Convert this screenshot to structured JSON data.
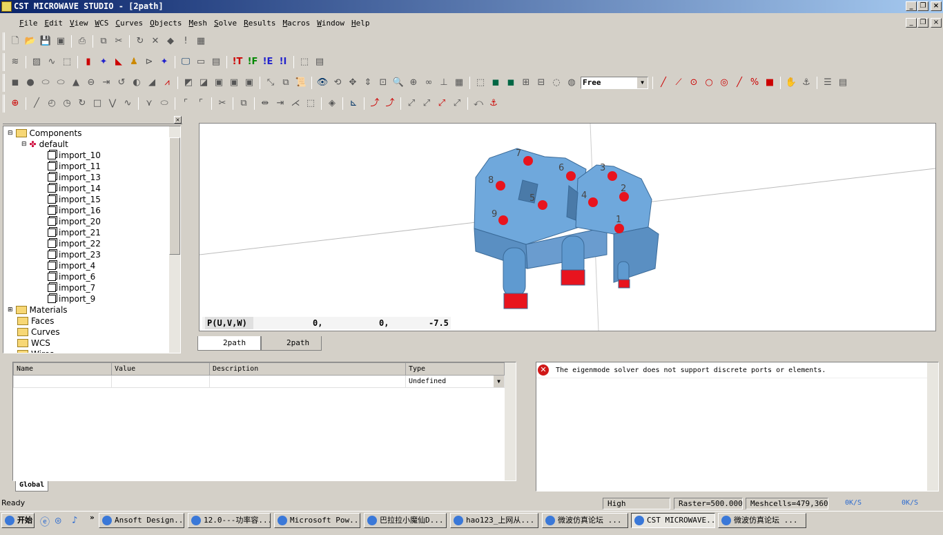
{
  "window": {
    "title": "CST MICROWAVE STUDIO - [2path]"
  },
  "menu": [
    "File",
    "Edit",
    "View",
    "WCS",
    "Curves",
    "Objects",
    "Mesh",
    "Solve",
    "Results",
    "Macros",
    "Window",
    "Help"
  ],
  "toolbar": {
    "view_mode": "Free"
  },
  "tree": {
    "root": "Components",
    "component": "default",
    "items": [
      "import_10",
      "import_11",
      "import_13",
      "import_14",
      "import_15",
      "import_16",
      "import_20",
      "import_21",
      "import_22",
      "import_23",
      "import_4",
      "import_6",
      "import_7",
      "import_9"
    ],
    "folders": [
      "Materials",
      "Faces",
      "Curves",
      "WCS",
      "Wires"
    ]
  },
  "viewport": {
    "coord_label": "P(U,V,W)",
    "u": "0,",
    "v": "0,",
    "w": "-7.5",
    "port_labels": [
      "1",
      "2",
      "3",
      "4",
      "5",
      "6",
      "7",
      "8",
      "9"
    ],
    "model_color": "#6fa8dc",
    "port_color": "#e8141e"
  },
  "tabs": [
    "2path",
    "2path"
  ],
  "params": {
    "headers": [
      "Name",
      "Value",
      "Description",
      "Type"
    ],
    "row_type": "Undefined",
    "tab": "Global"
  },
  "messages": [
    {
      "type": "error",
      "text": "The eigenmode solver does not support discrete ports or elements."
    }
  ],
  "status": {
    "left": "Ready",
    "mode": "High Frequency",
    "raster": "Raster=500.000",
    "meshcells": "Meshcells=479,360"
  },
  "taskbar": {
    "start": "开始",
    "tasks": [
      "Ansoft Design...",
      "12.0---功率容...",
      "Microsoft Pow...",
      "巴拉拉小魔仙D...",
      "hao123_上网从...",
      "微波仿真论坛 ...",
      "CST MICROWAVE...",
      "微波仿真论坛 ..."
    ],
    "net_down": "0K/S",
    "net_up": "0K/S"
  }
}
